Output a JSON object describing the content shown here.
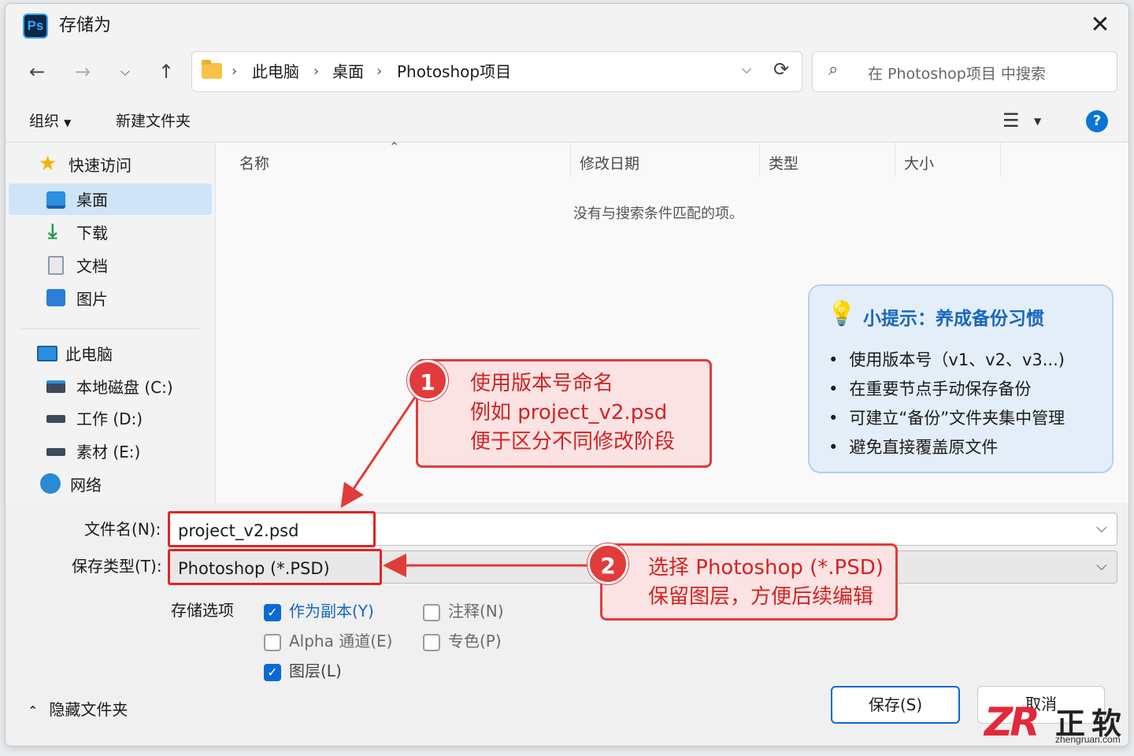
{
  "titlebar": {
    "app_badge": "Ps",
    "title": "存储为"
  },
  "nav": {
    "breadcrumbs": [
      "此电脑",
      "桌面",
      "Photoshop项目"
    ],
    "search_placeholder": "在 Photoshop项目 中搜索"
  },
  "toolbar": {
    "organize": "组织",
    "new_folder": "新建文件夹",
    "help": "?"
  },
  "sidebar": {
    "quick_access": "快速访问",
    "quick_items": [
      "桌面",
      "下载",
      "文档",
      "图片"
    ],
    "this_pc": "此电脑",
    "drives": [
      "本地磁盘 (C:)",
      "工作 (D:)",
      "素材 (E:)"
    ],
    "network": "网络"
  },
  "columns": [
    "名称",
    "修改日期",
    "类型",
    "大小"
  ],
  "empty_message": "没有与搜索条件匹配的项。",
  "tip": {
    "title": "小提示：养成备份习惯",
    "items": [
      "使用版本号（v1、v2、v3...)",
      "在重要节点手动保存备份",
      "可建立“备份”文件夹集中管理",
      "避免直接覆盖原文件"
    ]
  },
  "callout1": {
    "badge": "1",
    "lines": [
      "使用版本号命名",
      "例如  project_v2.psd",
      "便于区分不同修改阶段"
    ]
  },
  "callout2": {
    "badge": "2",
    "lines": [
      "选择 Photoshop (*.PSD)",
      "保留图层，方便后续编辑"
    ]
  },
  "form": {
    "filename_label": "文件名(N):",
    "filename_value": "project_v2.psd",
    "type_label": "保存类型(T):",
    "type_value": "Photoshop (*.PSD)",
    "options_label": "存储选项",
    "options": [
      {
        "label": "作为副本(Y)",
        "checked": true
      },
      {
        "label": "注释(N)",
        "checked": false
      },
      {
        "label": "Alpha 通道(E)",
        "checked": false
      },
      {
        "label": "专色(P)",
        "checked": false
      },
      {
        "label": "图层(L)",
        "checked": true
      }
    ],
    "hide_folders": "隐藏文件夹",
    "save": "保存(S)",
    "cancel": "取消"
  },
  "watermark": {
    "logo": "ZR",
    "name": "正软",
    "url": "zhengruan.com"
  },
  "colors": {
    "accent": "#0a6ad2",
    "callout_red": "#e23b3b",
    "tip_bg": "#e4eef8",
    "tip_title": "#1767c1"
  }
}
